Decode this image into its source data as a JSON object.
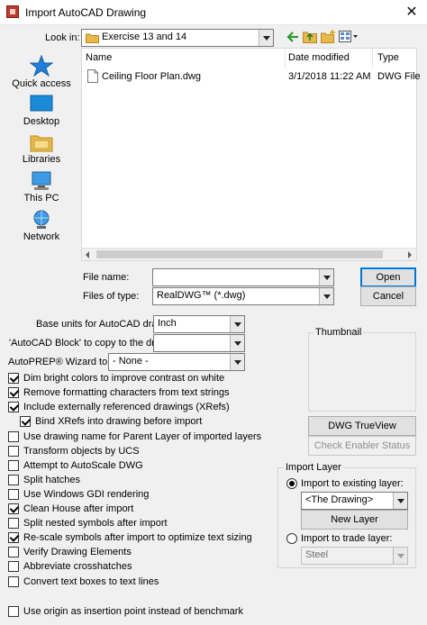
{
  "window": {
    "title": "Import AutoCAD Drawing",
    "close_glyph": "✕"
  },
  "lookin": {
    "label": "Look in:",
    "value": "Exercise 13 and 14"
  },
  "places": [
    {
      "label": "Quick access",
      "icon": "star-icon"
    },
    {
      "label": "Desktop",
      "icon": "desktop-icon"
    },
    {
      "label": "Libraries",
      "icon": "libraries-icon"
    },
    {
      "label": "This PC",
      "icon": "computer-icon"
    },
    {
      "label": "Network",
      "icon": "network-icon"
    }
  ],
  "filelist": {
    "columns": [
      "Name",
      "Date modified",
      "Type"
    ],
    "rows": [
      {
        "name": "Ceiling Floor Plan.dwg",
        "date": "3/1/2018 11:22 AM",
        "type": "DWG File"
      }
    ]
  },
  "filename": {
    "label": "File name:",
    "value": ""
  },
  "filetype": {
    "label": "Files of type:",
    "value": "RealDWG™ (*.dwg)"
  },
  "buttons": {
    "open": "Open",
    "cancel": "Cancel",
    "dwg_trueview": "DWG TrueView",
    "check_status": "Check Enabler Status",
    "new_layer": "New Layer"
  },
  "base_units": {
    "label": "Base units for AutoCAD drawing",
    "value": "Inch"
  },
  "acad_block": {
    "label": "'AutoCAD Block' to copy to the drawing",
    "value": ""
  },
  "autoprep": {
    "label": "AutoPREP® Wizard to Run",
    "value": "- None -"
  },
  "thumbnail": {
    "title": "Thumbnail"
  },
  "options": [
    {
      "label": "Dim bright colors to improve contrast on white",
      "checked": true
    },
    {
      "label": "Remove formatting characters from text strings",
      "checked": true
    },
    {
      "label": "Include externally referenced drawings (XRefs)",
      "checked": true
    },
    {
      "label": "Bind XRefs into drawing before import",
      "checked": true
    },
    {
      "label": "Use drawing name for Parent Layer of imported layers",
      "checked": false
    },
    {
      "label": "Transform objects by UCS",
      "checked": false
    },
    {
      "label": "Attempt to AutoScale DWG",
      "checked": false
    },
    {
      "label": "Split hatches",
      "checked": false
    },
    {
      "label": "Use Windows GDI rendering",
      "checked": false
    },
    {
      "label": "Clean House after import",
      "checked": true
    },
    {
      "label": "Split nested symbols after import",
      "checked": false
    },
    {
      "label": "Re-scale symbols after import to optimize text sizing",
      "checked": true
    },
    {
      "label": "Verify Drawing Elements",
      "checked": false
    },
    {
      "label": "Abbreviate crosshatches",
      "checked": false
    },
    {
      "label": "Convert text boxes to text lines",
      "checked": false
    },
    {
      "label": "Use origin as insertion point instead of benchmark",
      "checked": false
    }
  ],
  "import_layer": {
    "title": "Import Layer",
    "existing_label": "Import to existing layer:",
    "existing_value": "<The Drawing>",
    "trade_label": "Import to trade layer:",
    "trade_value": "Steel"
  },
  "colors": {
    "accent": "#0078d7",
    "folder": "#e8b84a"
  }
}
